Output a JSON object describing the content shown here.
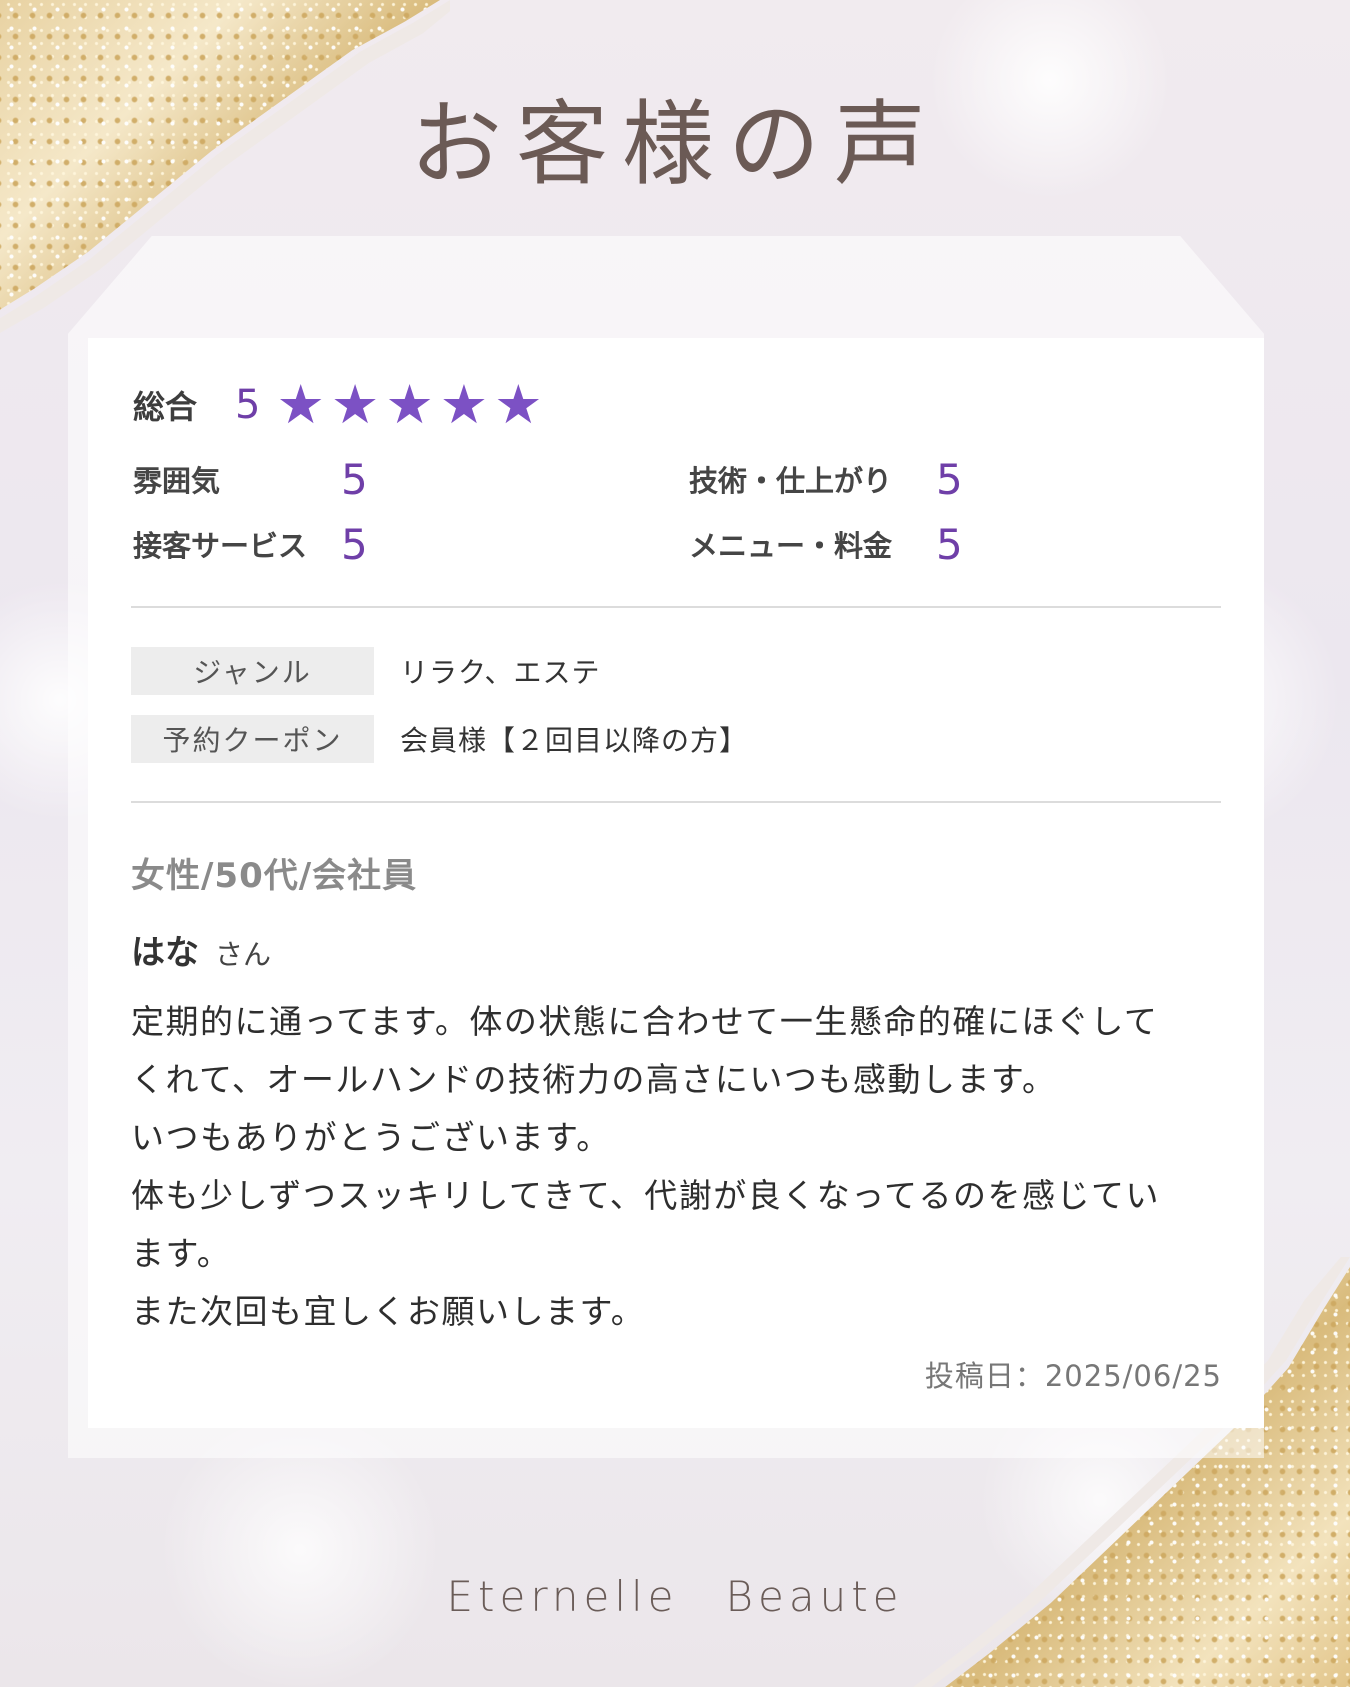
{
  "title": "お客様の声",
  "brand": "Eternelle　Beaute",
  "colors": {
    "accent": "#7c51c4",
    "score": "#6f3fa8",
    "title": "#6b5a55"
  },
  "overall": {
    "label": "総合",
    "score": "5",
    "stars": 5,
    "star_icon": "star-icon"
  },
  "ratings": [
    {
      "label": "雰囲気",
      "value": "5"
    },
    {
      "label": "技術・仕上がり",
      "value": "5"
    },
    {
      "label": "接客サービス",
      "value": "5"
    },
    {
      "label": "メニュー・料金",
      "value": "5"
    }
  ],
  "info": [
    {
      "label": "ジャンル",
      "value": "リラク、エステ"
    },
    {
      "label": "予約クーポン",
      "value": "会員様【２回目以降の方】"
    }
  ],
  "reviewer": {
    "profile": "女性/50代/会社員",
    "name": "はな",
    "suffix": "さん"
  },
  "review": {
    "lines": [
      "定期的に通ってます。体の状態に合わせて一生懸命的確にほぐして",
      "くれて、オールハンドの技術力の高さにいつも感動します。",
      "いつもありがとうございます。",
      "体も少しずつスッキリしてきて、代謝が良くなってるのを感じてい",
      "ます。",
      "また次回も宜しくお願いします。"
    ]
  },
  "post_date": "投稿日：2025/06/25"
}
